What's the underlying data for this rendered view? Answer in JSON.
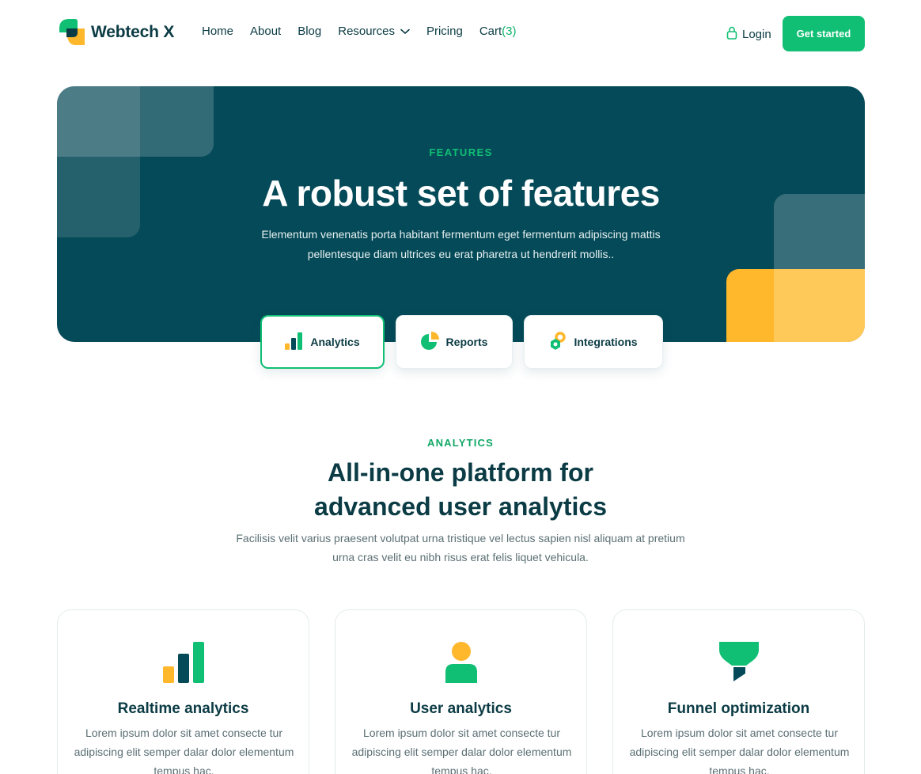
{
  "brand": {
    "name": "Webtech X"
  },
  "nav": {
    "items": [
      {
        "label": "Home"
      },
      {
        "label": "About"
      },
      {
        "label": "Blog"
      },
      {
        "label": "Resources"
      },
      {
        "label": "Pricing"
      }
    ],
    "cart": {
      "label": "Cart",
      "count": "(3)"
    },
    "login_label": "Login",
    "cta_label": "Get started"
  },
  "hero": {
    "eyebrow": "FEATURES",
    "title": "A robust set of features",
    "subtitle": "Elementum venenatis porta habitant fermentum eget fermentum adipiscing mattis pellentesque diam ultrices eu erat pharetra ut hendrerit mollis.."
  },
  "tabs": [
    {
      "label": "Analytics",
      "icon": "bar-chart-icon",
      "active": true
    },
    {
      "label": "Reports",
      "icon": "pie-chart-icon",
      "active": false
    },
    {
      "label": "Integrations",
      "icon": "integrations-icon",
      "active": false
    }
  ],
  "section": {
    "eyebrow": "ANALYTICS",
    "title_line1": "All-in-one platform for",
    "title_line2": "advanced user analytics",
    "subtitle": "Facilisis velit varius praesent volutpat urna tristique vel lectus sapien nisl aliquam at pretium urna cras velit eu nibh risus erat felis liquet vehicula."
  },
  "cards": [
    {
      "title": "Realtime analytics",
      "text": "Lorem ipsum dolor sit amet consecte tur adipiscing elit semper dalar dolor elementum tempus hac.",
      "icon": "bar-chart-icon"
    },
    {
      "title": "User analytics",
      "text": "Lorem ipsum dolor sit amet consecte tur adipiscing elit semper dalar dolor elementum tempus hac.",
      "icon": "user-icon"
    },
    {
      "title": "Funnel optimization",
      "text": "Lorem ipsum dolor sit amet consecte tur adipiscing elit semper dalar dolor elementum tempus hac.",
      "icon": "funnel-icon"
    }
  ],
  "colors": {
    "primary": "#10bf74",
    "dark": "#054a58",
    "accent": "#ffb72b",
    "text": "#0b3b44"
  }
}
